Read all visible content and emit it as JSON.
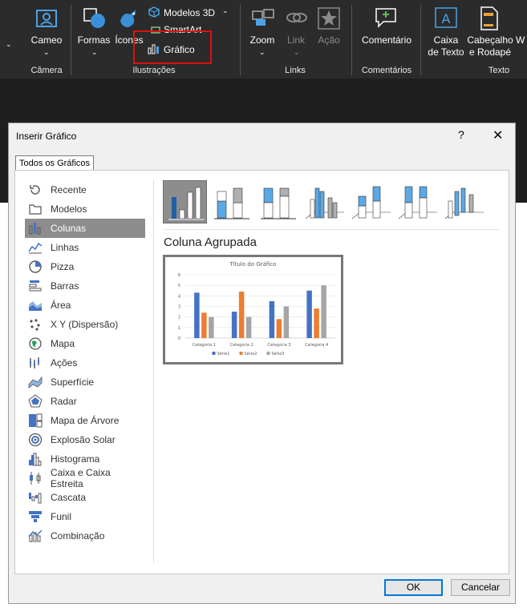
{
  "ribbon": {
    "camera": {
      "label": "Cameo",
      "group": "Câmera"
    },
    "shapes": {
      "label": "Formas"
    },
    "icons": {
      "label": "Ícones"
    },
    "models3d": {
      "label": "Modelos 3D"
    },
    "smartart": {
      "label": "SmartArt"
    },
    "chart": {
      "label": "Gráfico"
    },
    "illustrations_group": "Ilustrações",
    "zoom": {
      "label": "Zoom"
    },
    "link": {
      "label": "Link"
    },
    "action": {
      "label": "Ação"
    },
    "links_group": "Links",
    "comment": {
      "label": "Comentário"
    },
    "comments_group": "Comentários",
    "textbox": {
      "line1": "Caixa",
      "line2": "de Texto"
    },
    "headerfooter": {
      "line1": "Cabeçalho",
      "line2": "e Rodapé"
    },
    "wordart": {
      "label": "W"
    },
    "text_group": "Texto",
    "colors": {
      "bg": "#2b2b2b",
      "highlight": "#e01010"
    }
  },
  "dialog": {
    "title": "Inserir Gráfico",
    "help": "?",
    "close": "✕",
    "tab": "Todos os Gráficos",
    "categories": [
      {
        "label": "Recente",
        "icon": "recent-icon"
      },
      {
        "label": "Modelos",
        "icon": "templates-icon"
      },
      {
        "label": "Colunas",
        "icon": "column-chart-icon",
        "selected": true
      },
      {
        "label": "Linhas",
        "icon": "line-chart-icon"
      },
      {
        "label": "Pizza",
        "icon": "pie-chart-icon"
      },
      {
        "label": "Barras",
        "icon": "bar-chart-icon"
      },
      {
        "label": "Área",
        "icon": "area-chart-icon"
      },
      {
        "label": "X Y (Dispersão)",
        "icon": "scatter-chart-icon"
      },
      {
        "label": "Mapa",
        "icon": "map-chart-icon"
      },
      {
        "label": "Ações",
        "icon": "stock-chart-icon"
      },
      {
        "label": "Superfície",
        "icon": "surface-chart-icon"
      },
      {
        "label": "Radar",
        "icon": "radar-chart-icon"
      },
      {
        "label": "Mapa de Árvore",
        "icon": "treemap-chart-icon"
      },
      {
        "label": "Explosão Solar",
        "icon": "sunburst-chart-icon"
      },
      {
        "label": "Histograma",
        "icon": "histogram-chart-icon"
      },
      {
        "label": "Caixa e Caixa Estreita",
        "icon": "box-whisker-chart-icon"
      },
      {
        "label": "Cascata",
        "icon": "waterfall-chart-icon"
      },
      {
        "label": "Funil",
        "icon": "funnel-chart-icon"
      },
      {
        "label": "Combinação",
        "icon": "combo-chart-icon"
      }
    ],
    "subtypes": [
      {
        "icon": "clustered-column-icon",
        "selected": true
      },
      {
        "icon": "stacked-column-icon"
      },
      {
        "icon": "100-stacked-column-icon"
      },
      {
        "icon": "3d-clustered-column-icon"
      },
      {
        "icon": "3d-stacked-column-icon"
      },
      {
        "icon": "3d-100-stacked-column-icon"
      },
      {
        "icon": "3d-column-icon"
      }
    ],
    "subtype_name": "Coluna Agrupada",
    "ok": "OK",
    "cancel": "Cancelar",
    "colors": {
      "selected": "#8d8d8d",
      "accent": "#0078d7"
    }
  },
  "chart_data": {
    "type": "bar",
    "title": "Título do Gráfico",
    "categories": [
      "Categoria 1",
      "Categoria 2",
      "Categoria 3",
      "Categoria 4"
    ],
    "series": [
      {
        "name": "Série1",
        "values": [
          4.3,
          2.5,
          3.5,
          4.5
        ],
        "color": "#4472c4"
      },
      {
        "name": "Série2",
        "values": [
          2.4,
          4.4,
          1.8,
          2.8
        ],
        "color": "#ed7d31"
      },
      {
        "name": "Série3",
        "values": [
          2,
          2,
          3,
          5
        ],
        "color": "#a5a5a5"
      }
    ],
    "ylim": [
      0,
      6
    ],
    "yticks": [
      "0",
      "1",
      "2",
      "3",
      "4",
      "5",
      "6"
    ],
    "grid": true,
    "legend": "bottom"
  }
}
